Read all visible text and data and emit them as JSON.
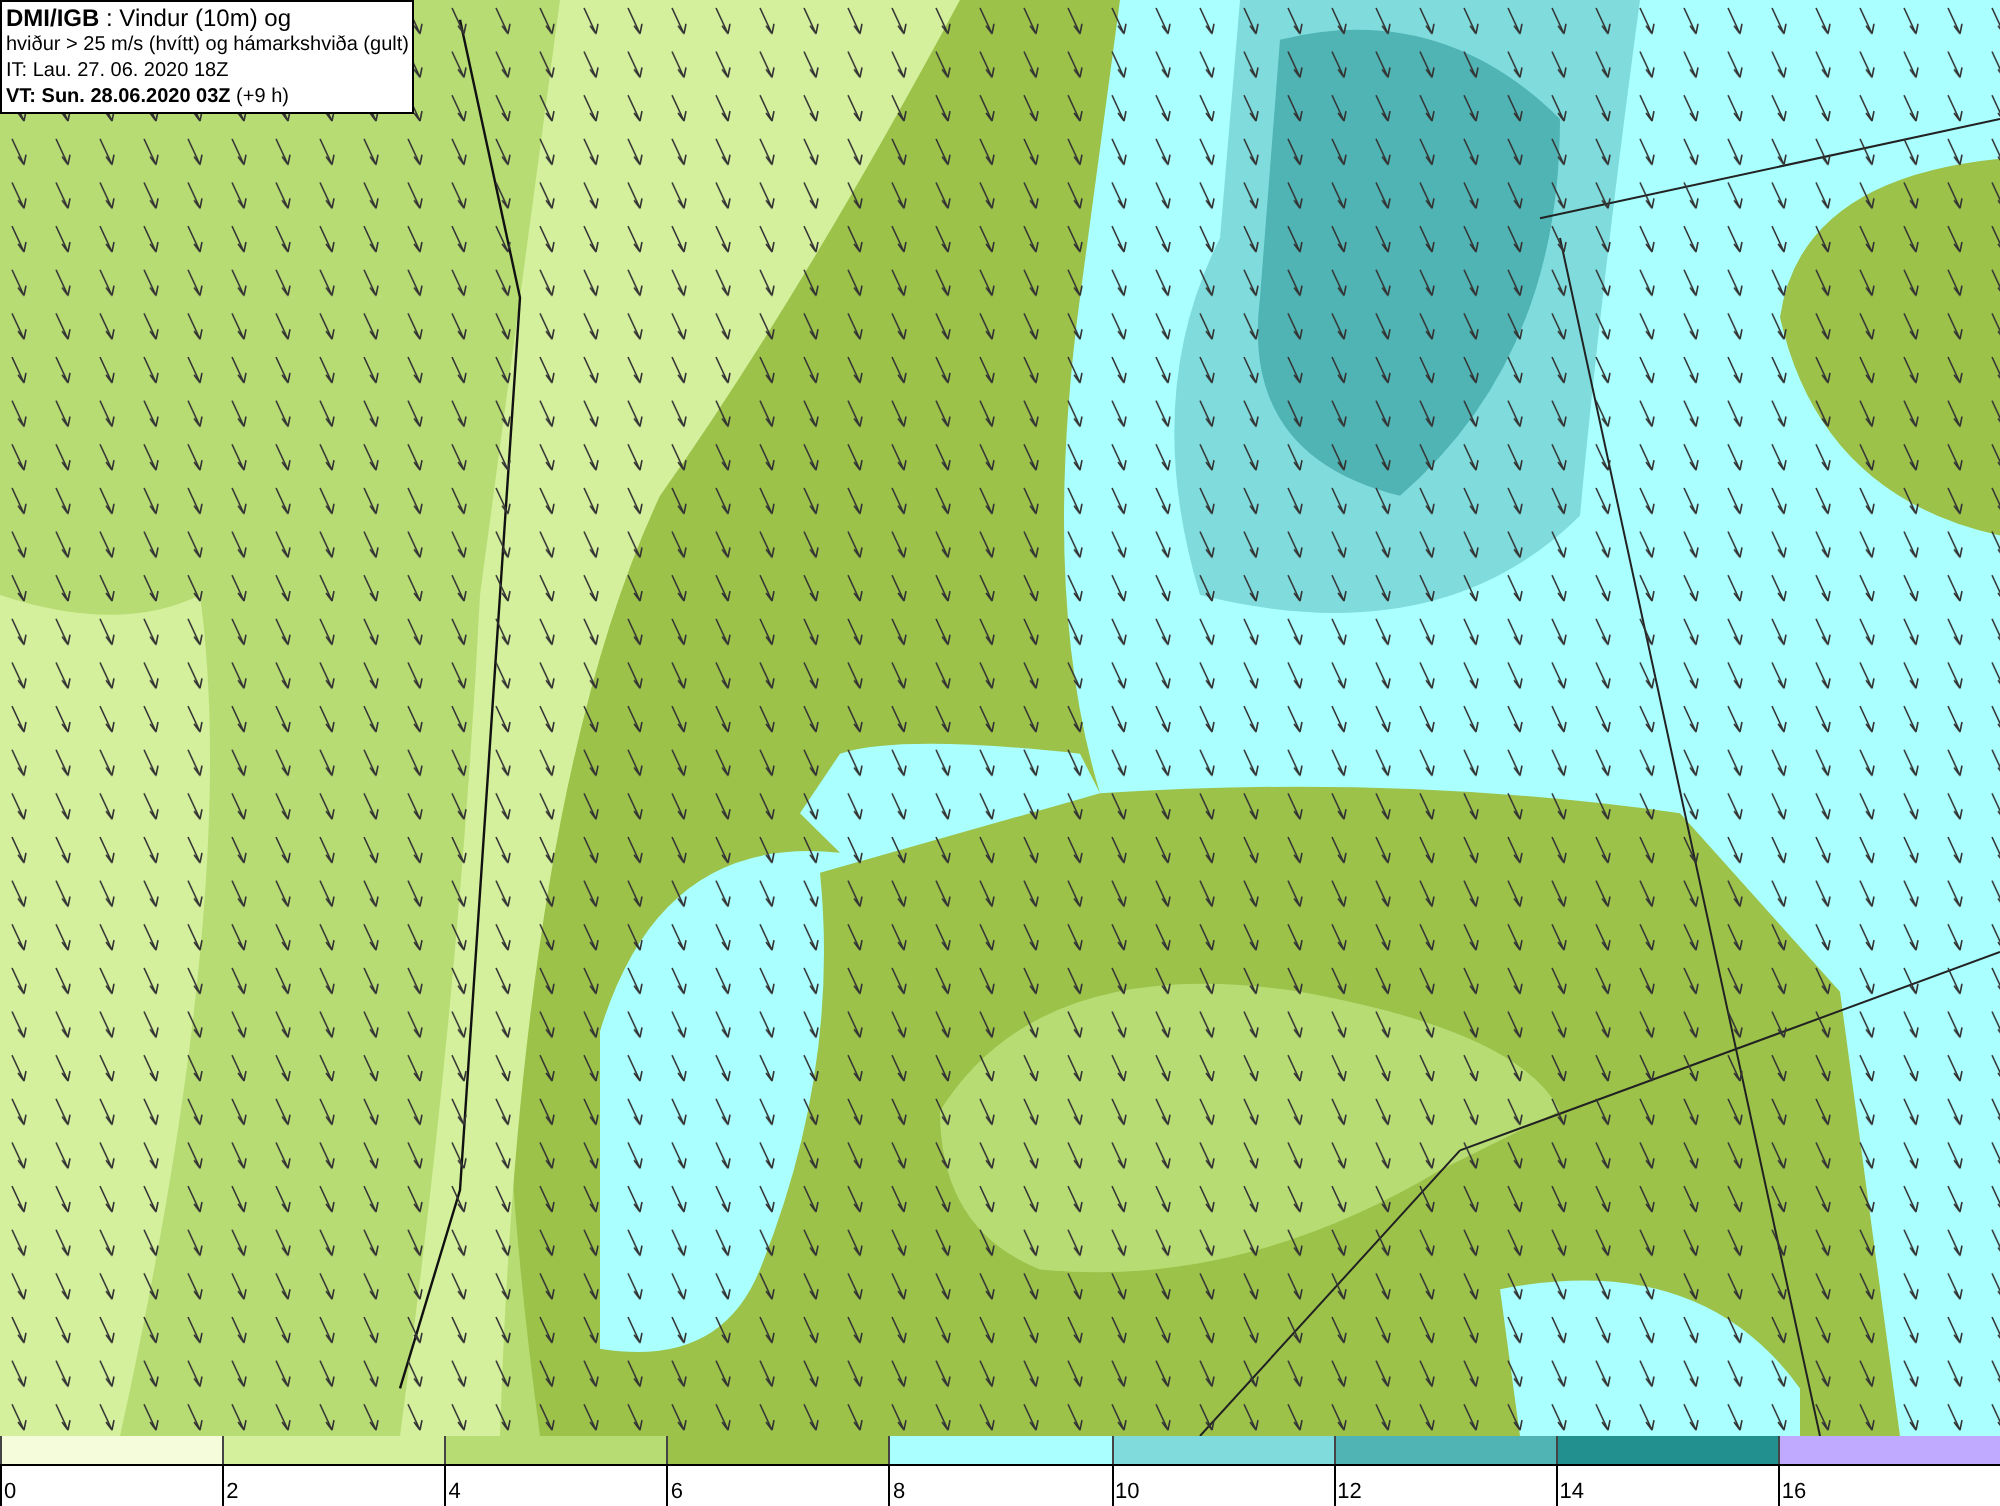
{
  "title_box": {
    "lines": [
      "**DMI/IGB** : Vindur (10m) og",
      "hviður > 25 m/s (hvítt) og hámarkshviða (gult)",
      "IT: Lau. 27. 06. 2020 18Z",
      "**VT: Sun. 28.06.2020 03Z** (+9 h)"
    ]
  },
  "legend": {
    "bins": [
      {
        "color": "#f5fcdc"
      },
      {
        "color": "#d4f09c"
      },
      {
        "color": "#b8dc74"
      },
      {
        "color": "#9cc24a"
      },
      {
        "color": "#aaffff"
      },
      {
        "color": "#80dcdc"
      },
      {
        "color": "#50b4b4"
      },
      {
        "color": "#239090"
      },
      {
        "color": "#c0aaff"
      }
    ],
    "labels": [
      "0",
      "2",
      "4",
      "6",
      "8",
      "10",
      "12",
      "14",
      "16"
    ]
  }
}
